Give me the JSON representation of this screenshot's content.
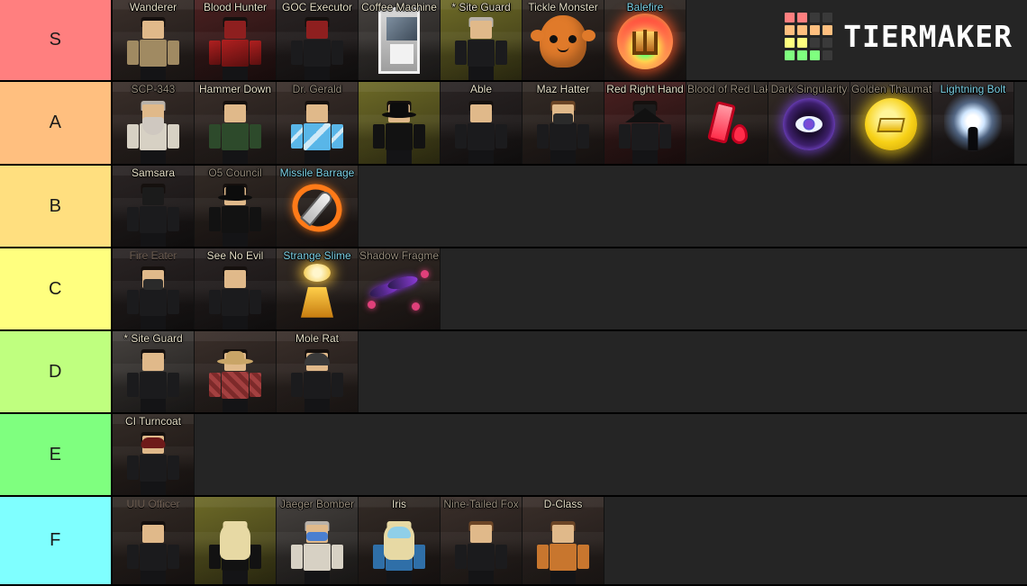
{
  "app": {
    "brand": "TIERMAKER"
  },
  "logo": {
    "cells": [
      "#ff7f7f",
      "#ff7f7f",
      "#3a3a3a",
      "#3a3a3a",
      "#ffbf7f",
      "#ffbf7f",
      "#ffbf7f",
      "#ffbf7f",
      "#ffff7f",
      "#ffff7f",
      "#3a3a3a",
      "#3a3a3a",
      "#7fff7f",
      "#7fff7f",
      "#7fff7f",
      "#3a3a3a"
    ]
  },
  "tiers": [
    {
      "label": "S",
      "color": "#ff7f7f",
      "items": [
        {
          "name": "Wanderer",
          "art": "wanderer"
        },
        {
          "name": "Blood Hunter",
          "art": "blood-hunter"
        },
        {
          "name": "GOC Executor",
          "art": "goc-executor"
        },
        {
          "name": "Coffee Machine",
          "art": "coffee-machine"
        },
        {
          "name": "* Site Guard",
          "art": "site-guard-olive"
        },
        {
          "name": "Tickle Monster",
          "art": "tickle-monster"
        },
        {
          "name": "Balefire",
          "art": "balefire"
        }
      ]
    },
    {
      "label": "A",
      "color": "#ffbf7f",
      "items": [
        {
          "name": "SCP-343",
          "art": "scp-343"
        },
        {
          "name": "Hammer Down",
          "art": "hammer-down"
        },
        {
          "name": "Dr. Gerald",
          "art": "dr-gerald"
        },
        {
          "name": "",
          "art": "cowboy-agent"
        },
        {
          "name": "Able",
          "art": "able"
        },
        {
          "name": "Maz Hatter",
          "art": "maz-hatter"
        },
        {
          "name": "Red Right Hand",
          "art": "red-right-hand"
        },
        {
          "name": "Blood of Red Lake",
          "art": "blood-of-red-lake"
        },
        {
          "name": "Dark Singularity",
          "art": "dark-singularity"
        },
        {
          "name": "Golden Thaumaturgy",
          "art": "golden-thaumaturgy"
        },
        {
          "name": "Lightning Bolt",
          "art": "lightning-bolt"
        }
      ]
    },
    {
      "label": "B",
      "color": "#ffdf7f",
      "items": [
        {
          "name": "Samsara",
          "art": "samsara"
        },
        {
          "name": "O5 Council",
          "art": "o5-council"
        },
        {
          "name": "Missile Barrage",
          "art": "missile-barrage"
        }
      ]
    },
    {
      "label": "C",
      "color": "#ffff7f",
      "items": [
        {
          "name": "Fire Eater",
          "art": "fire-eater"
        },
        {
          "name": "See No Evil",
          "art": "see-no-evil"
        },
        {
          "name": "Strange Slime",
          "art": "strange-slime"
        },
        {
          "name": "Shadow Fragment",
          "art": "shadow-fragment"
        }
      ]
    },
    {
      "label": "D",
      "color": "#bfff7f",
      "items": [
        {
          "name": "* Site Guard",
          "art": "site-guard"
        },
        {
          "name": "",
          "art": "cowboy-plaid"
        },
        {
          "name": "Mole Rat",
          "art": "mole-rat"
        }
      ]
    },
    {
      "label": "E",
      "color": "#7fff7f",
      "items": [
        {
          "name": "CI Turncoat",
          "art": "ci-turncoat"
        }
      ]
    },
    {
      "label": "F",
      "color": "#7fffff",
      "items": [
        {
          "name": "UIU Officer",
          "art": "uiu-officer"
        },
        {
          "name": "",
          "art": "blonde-woman"
        },
        {
          "name": "Jaeger Bomber",
          "art": "jaeger-bomber"
        },
        {
          "name": "Iris",
          "art": "iris"
        },
        {
          "name": "Nine-Tailed Fox",
          "art": "nine-tailed-fox"
        },
        {
          "name": "D-Class",
          "art": "d-class"
        }
      ]
    }
  ]
}
